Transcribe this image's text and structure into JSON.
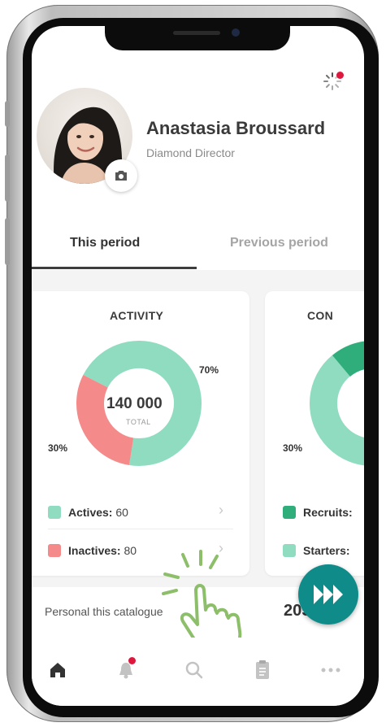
{
  "profile": {
    "name": "Anastasia Broussard",
    "title": "Diamond Director"
  },
  "tabs": [
    {
      "label": "This period",
      "active": true
    },
    {
      "label": "Previous period",
      "active": false
    }
  ],
  "activity_card": {
    "title": "ACTIVITY",
    "total_value": "140 000",
    "total_label": "TOTAL",
    "pct_actives": "70%",
    "pct_inactives": "30%",
    "legend": [
      {
        "label": "Actives:",
        "value": "60",
        "color": "#8fdcc0"
      },
      {
        "label": "Inactives:",
        "value": "80",
        "color": "#f48a8a"
      }
    ]
  },
  "conversion_card": {
    "title": "CON",
    "pct_left": "30%",
    "legend": [
      {
        "label": "Recruits:",
        "color": "#2fae7c"
      },
      {
        "label": "Starters:",
        "color": "#8fdcc0"
      }
    ]
  },
  "personal": {
    "label": "Personal this catalogue",
    "value": "205"
  },
  "nav": [
    "home-icon",
    "bell-icon",
    "search-icon",
    "clipboard-icon",
    "more-icon"
  ],
  "colors": {
    "actives": "#8fdcc0",
    "inactives": "#f48a8a",
    "recruits": "#2fae7c",
    "fab": "#0f8c8a",
    "badge": "#e0173c"
  },
  "chart_data": {
    "type": "pie",
    "title": "ACTIVITY",
    "categories": [
      "Actives",
      "Inactives"
    ],
    "values": [
      70,
      30
    ]
  }
}
